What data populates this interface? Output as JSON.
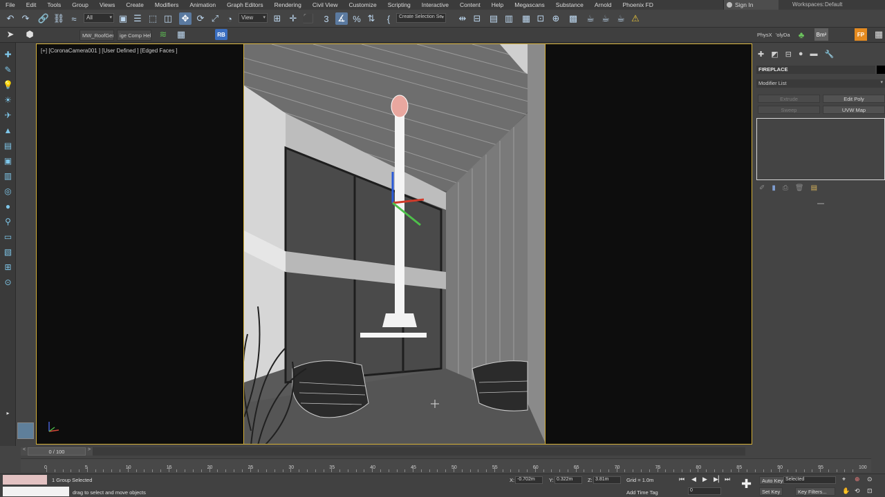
{
  "menubar": {
    "items": [
      "File",
      "Edit",
      "Tools",
      "Group",
      "Views",
      "Create",
      "Modifiers",
      "Animation",
      "Graph Editors",
      "Rendering",
      "Civil View",
      "Customize",
      "Scripting",
      "Interactive",
      "Content",
      "Help",
      "Megascans",
      "Substance",
      "Arnold",
      "Phoenix FD"
    ],
    "sign_in": "Sign In",
    "workspaces_label": "Workspaces:",
    "workspaces_value": "Default"
  },
  "toolbar": {
    "selection_filter": "All",
    "reference_coord": "View",
    "named_selection_set": "Create Selection Se"
  },
  "ribbon": {
    "tab1": "MW_RoofGen",
    "tab2": "ige Comp Help",
    "rb_badge": "RB",
    "physx": "PhysX",
    "polyda": "'olyDa",
    "bm2": "Bm²",
    "fp": "FP"
  },
  "viewport": {
    "label": "[+] [CoronaCamera001 ] [User Defined ] [Edged Faces ]"
  },
  "command_panel": {
    "object_name": "FIREPLACE",
    "modifier_list": "Modifier List",
    "buttons": {
      "extrude": "Extrude",
      "edit_poly": "Edit Poly",
      "sweep": "Sweep",
      "uvw_map": "UVW Map"
    }
  },
  "timeline": {
    "frame_display": "0 / 100",
    "ticks": [
      "0",
      "5",
      "10",
      "15",
      "20",
      "25",
      "30",
      "35",
      "40",
      "45",
      "50",
      "55",
      "60",
      "65",
      "70",
      "75",
      "80",
      "85",
      "90",
      "95",
      "100"
    ]
  },
  "status": {
    "selection": "1 Group Selected",
    "prompt": "drag to select and move objects",
    "x_label": "X:",
    "x_value": "-0.702m",
    "y_label": "Y:",
    "y_value": "0.322m",
    "z_label": "Z:",
    "z_value": "3.81m",
    "grid": "Grid = 1.0m",
    "add_time_tag": "Add Time Tag",
    "auto_key": "Auto Key",
    "set_key": "Set Key",
    "key_mode": "Selected",
    "key_filters": "Key Filters...",
    "current_frame": "0"
  },
  "colors": {
    "viewport_border": "#d6b13a",
    "accent_blue": "#5b7aa0",
    "icon_cyan": "#7ec6e9"
  }
}
